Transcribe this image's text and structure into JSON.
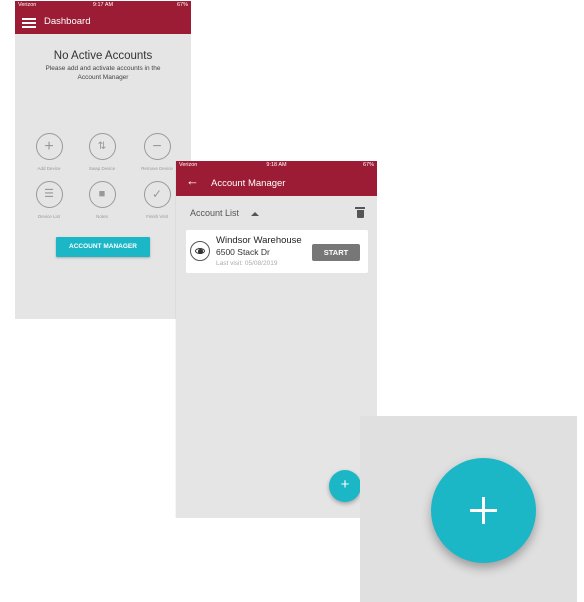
{
  "dashboard": {
    "status": {
      "carrier": "Verizon",
      "time": "9:17 AM",
      "battery": "67%"
    },
    "title": "Dashboard",
    "empty_title": "No Active Accounts",
    "empty_subtitle": "Please add and activate accounts in the Account Manager",
    "actions": [
      {
        "icon": "plus-icon",
        "label": "Add Device"
      },
      {
        "icon": "swap-icon",
        "label": "Swap Device"
      },
      {
        "icon": "minus-icon",
        "label": "Remove Device"
      },
      {
        "icon": "list-icon",
        "label": "Device List"
      },
      {
        "icon": "notes-icon",
        "label": "Notes"
      },
      {
        "icon": "check-icon",
        "label": "Finish Visit"
      }
    ],
    "account_manager_button": "ACCOUNT MANAGER"
  },
  "account_manager": {
    "status": {
      "carrier": "Verizon",
      "time": "9:18 AM",
      "battery": "67%"
    },
    "title": "Account Manager",
    "list_label": "Account List",
    "accounts": [
      {
        "name": "Windsor Warehouse",
        "address": "6500 Stack Dr",
        "last_visit": "Last visit: 05/08/2019",
        "action": "START"
      }
    ],
    "fab_label": "+"
  },
  "colors": {
    "brand": "#9b1c34",
    "accent": "#1bb7c6",
    "background": "#e5e5e5"
  }
}
